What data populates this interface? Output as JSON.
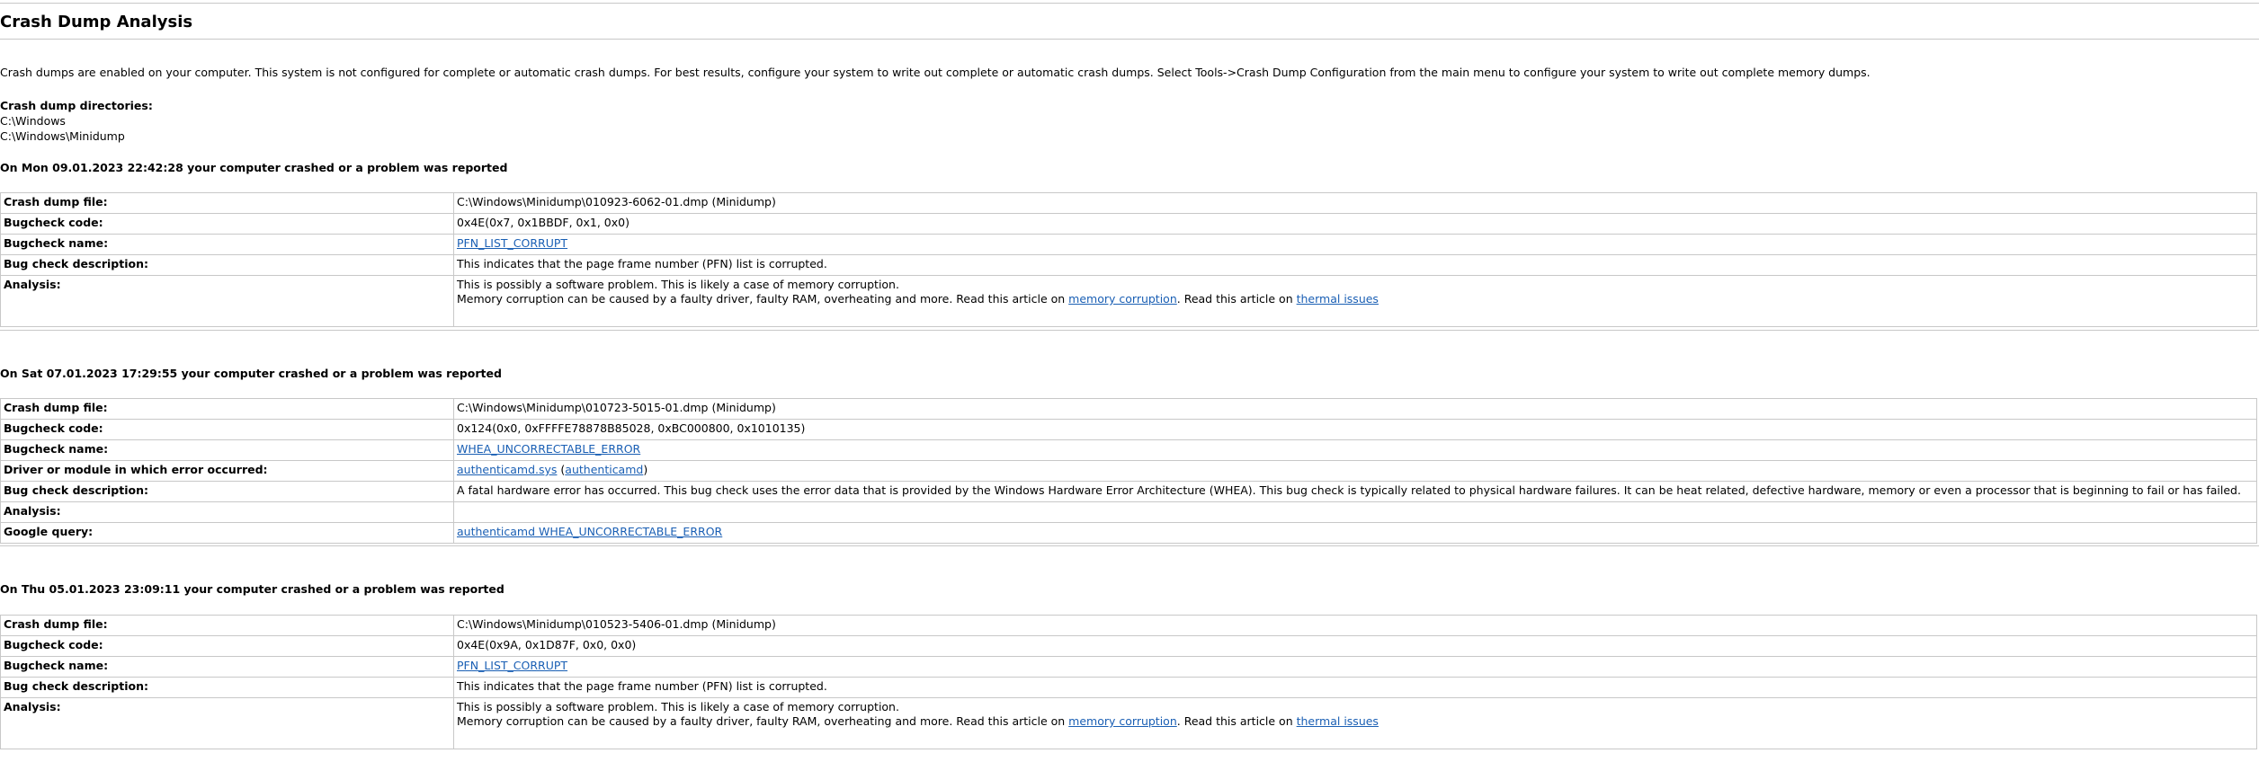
{
  "title": "Crash Dump Analysis",
  "intro": "Crash dumps are enabled on your computer. This system is not configured for complete or automatic crash dumps. For best results, configure your system to write out complete or automatic crash dumps. Select Tools->Crash Dump Configuration from the main menu to configure your system to write out complete memory dumps.",
  "dirs": {
    "label": "Crash dump directories:",
    "items": [
      "C:\\Windows",
      "C:\\Windows\\Minidump"
    ]
  },
  "labels": {
    "crash_dump_file": "Crash dump file:",
    "bugcheck_code": "Bugcheck code:",
    "bugcheck_name": "Bugcheck name:",
    "driver_module": "Driver or module in which error occurred:",
    "bug_check_description": "Bug check description:",
    "analysis": "Analysis:",
    "google_query": "Google query:"
  },
  "crashes": [
    {
      "heading": "On Mon 09.01.2023 22:42:28 your computer crashed or a problem was reported",
      "file": "C:\\Windows\\Minidump\\010923-6062-01.dmp (Minidump)",
      "code": "0x4E(0x7, 0x1BBDF, 0x1, 0x0)",
      "name": "PFN_LIST_CORRUPT",
      "description": "This indicates that the page frame number (PFN) list is corrupted.",
      "analysis": {
        "line1": "This is possibly a software problem. This is likely a case of memory corruption.",
        "line2_prefix": "Memory corruption can be caused by a faulty driver, faulty RAM, overheating and more. Read this article on ",
        "link1": "memory corruption",
        "middle": ". Read this article on ",
        "link2": "thermal issues"
      }
    },
    {
      "heading": "On Sat 07.01.2023 17:29:55 your computer crashed or a problem was reported",
      "file": "C:\\Windows\\Minidump\\010723-5015-01.dmp (Minidump)",
      "code": "0x124(0x0, 0xFFFFE78878B85028, 0xBC000800, 0x1010135)",
      "name": "WHEA_UNCORRECTABLE_ERROR",
      "driver_link1": "authenticamd.sys",
      "driver_open": " (",
      "driver_link2": "authenticamd",
      "driver_close": ")",
      "description": "A fatal hardware error has occurred. This bug check uses the error data that is provided by the Windows Hardware Error Architecture (WHEA). This bug check is typically related to physical hardware failures. It can be heat related, defective hardware, memory or even a processor that is beginning to fail or has failed.",
      "google_query": "authenticamd WHEA_UNCORRECTABLE_ERROR"
    },
    {
      "heading": "On Thu 05.01.2023 23:09:11 your computer crashed or a problem was reported",
      "file": "C:\\Windows\\Minidump\\010523-5406-01.dmp (Minidump)",
      "code": "0x4E(0x9A, 0x1D87F, 0x0, 0x0)",
      "name": "PFN_LIST_CORRUPT",
      "description": "This indicates that the page frame number (PFN) list is corrupted.",
      "analysis": {
        "line1": "This is possibly a software problem. This is likely a case of memory corruption.",
        "line2_prefix": "Memory corruption can be caused by a faulty driver, faulty RAM, overheating and more. Read this article on ",
        "link1": "memory corruption",
        "middle": ". Read this article on ",
        "link2": "thermal issues"
      }
    }
  ],
  "colors": {
    "link": "#1a5fb4",
    "border": "#c8c8c8"
  }
}
